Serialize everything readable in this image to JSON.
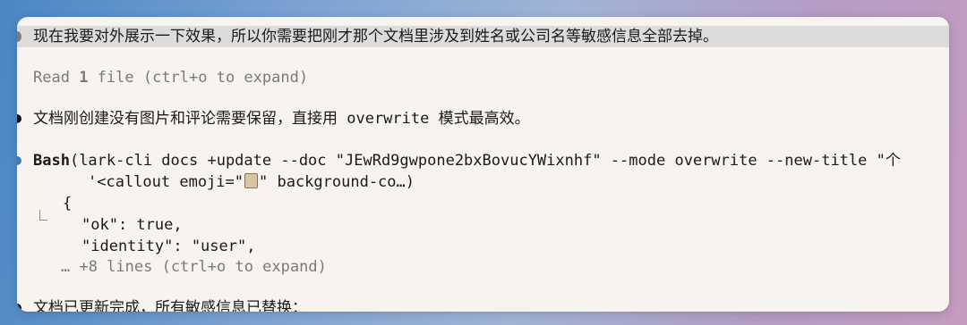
{
  "user_message": "现在我要对外展示一下效果，所以你需要把刚才那个文档里涉及到姓名或公司名等敏感信息全部去掉。",
  "read_summary": {
    "prefix": "Read ",
    "count": "1",
    "suffix": " file (ctrl+o to expand)"
  },
  "assistant_message": "文档刚创建没有图片和评论需要保留，直接用 overwrite 模式最高效。",
  "bash_call": {
    "tool_name": "Bash",
    "command": "(lark-cli docs +update --doc \"JEwRd9gwpone2bxBovucYWixnhf\" --mode overwrite --new-title \"个",
    "command_cont_prefix": "'<callout emoji=\"",
    "command_cont_suffix": "\" background-co…)"
  },
  "output": {
    "line1": "{",
    "line2": "\"ok\": true,",
    "line3": "\"identity\": \"user\",",
    "more": "… +8 lines (ctrl+o to expand)"
  },
  "final_message": "文档已更新完成，所有敏感信息已替换："
}
